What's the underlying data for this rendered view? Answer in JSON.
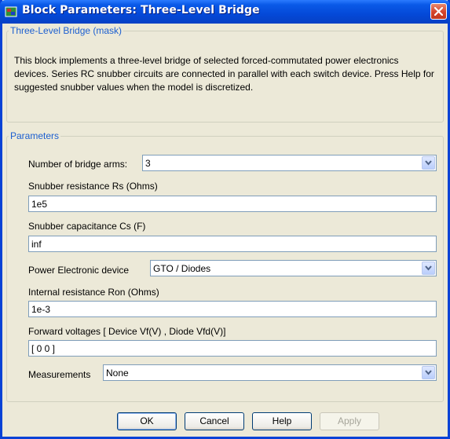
{
  "window": {
    "title": "Block Parameters: Three-Level Bridge",
    "icon": "simulink-block-icon",
    "close_icon": "close-icon"
  },
  "description_group": {
    "legend": "Three-Level Bridge (mask)",
    "text": "This block implements a three-level bridge of selected forced-commutated power electronics devices.  Series RC snubber circuits are connected in parallel with each switch device.  Press Help for suggested snubber values when the model is discretized."
  },
  "parameters_group": {
    "legend": "Parameters",
    "bridge_arms": {
      "label": "Number of bridge arms:",
      "value": "3"
    },
    "snubber_resistance": {
      "label": "Snubber resistance Rs (Ohms)",
      "value": "1e5"
    },
    "snubber_capacitance": {
      "label": "Snubber capacitance Cs (F)",
      "value": "inf"
    },
    "power_device": {
      "label": "Power Electronic device",
      "value": "GTO / Diodes"
    },
    "internal_resistance": {
      "label": "Internal resistance Ron (Ohms)",
      "value": "1e-3"
    },
    "forward_voltages": {
      "label": "Forward voltages  [ Device Vf(V) , Diode Vfd(V)]",
      "value": "[ 0 0 ]"
    },
    "measurements": {
      "label": "Measurements",
      "value": "None"
    }
  },
  "buttons": {
    "ok": "OK",
    "cancel": "Cancel",
    "help": "Help",
    "apply": "Apply"
  },
  "colors": {
    "title_bar": "#0449d8",
    "dialog_background": "#ece9d8",
    "legend_text": "#1c5fd0",
    "field_border": "#7f9db9"
  }
}
